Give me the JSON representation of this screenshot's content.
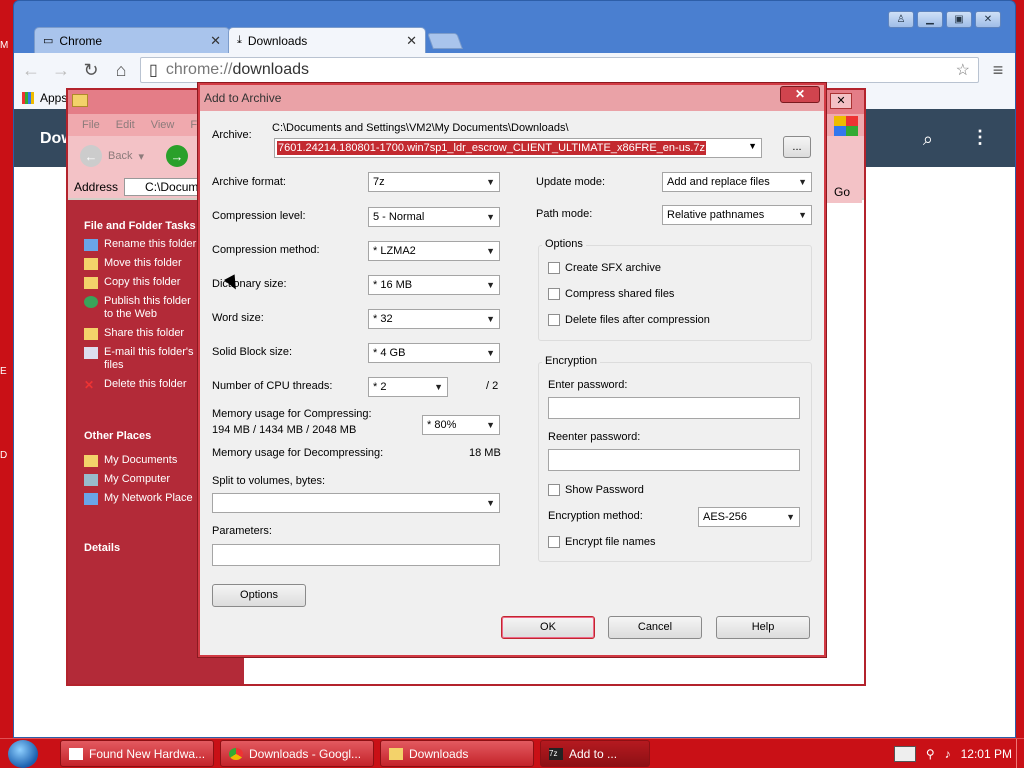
{
  "chrome": {
    "tabs": [
      {
        "label": "Chrome",
        "icon": "page-icon"
      },
      {
        "label": "Downloads",
        "icon": "download-icon"
      }
    ],
    "url_scheme": "chrome://",
    "url_path": "downloads",
    "bookmarks_label": "Apps",
    "page_title": "Dow"
  },
  "explorer": {
    "menu": [
      "File",
      "Edit",
      "View",
      "F"
    ],
    "back_label": "Back",
    "address_label": "Address",
    "address_value": "C:\\Docume",
    "go_label": "Go",
    "file_tasks_title": "File and Folder Tasks",
    "file_tasks": [
      "Rename this folder",
      "Move this folder",
      "Copy this folder",
      "Publish this folder to the Web",
      "Share this folder",
      "E-mail this folder's files",
      "Delete this folder"
    ],
    "other_places_title": "Other Places",
    "other_places": [
      "My Documents",
      "My Computer",
      "My Network Place"
    ],
    "details_title": "Details"
  },
  "dialog": {
    "title": "Add to Archive",
    "close": "✕",
    "archive_label": "Archive:",
    "archive_path": "C:\\Documents and Settings\\VM2\\My Documents\\Downloads\\",
    "archive_name": "7601.24214.180801-1700.win7sp1_ldr_escrow_CLIENT_ULTIMATE_x86FRE_en-us.7z",
    "browse": "...",
    "format_label": "Archive format:",
    "format_value": "7z",
    "level_label": "Compression level:",
    "level_value": "5 - Normal",
    "method_label": "Compression method:",
    "method_value": "* LZMA2",
    "dict_label": "Dictionary size:",
    "dict_value": "* 16 MB",
    "word_label": "Word size:",
    "word_value": "* 32",
    "solid_label": "Solid Block size:",
    "solid_value": "* 4 GB",
    "threads_label": "Number of CPU threads:",
    "threads_value": "* 2",
    "threads_total": "/ 2",
    "mem_comp_label": "Memory usage for Compressing:",
    "mem_comp_value": "194 MB / 1434 MB / 2048 MB",
    "mem_comp_pct": "* 80%",
    "mem_decomp_label": "Memory usage for Decompressing:",
    "mem_decomp_value": "18 MB",
    "split_label": "Split to volumes, bytes:",
    "split_value": "",
    "params_label": "Parameters:",
    "params_value": "",
    "options_button": "Options",
    "update_label": "Update mode:",
    "update_value": "Add and replace files",
    "path_label": "Path mode:",
    "path_value": "Relative pathnames",
    "options_group": "Options",
    "opt_sfx": "Create SFX archive",
    "opt_shared": "Compress shared files",
    "opt_delete": "Delete files after compression",
    "enc_group": "Encryption",
    "enter_pw_label": "Enter password:",
    "reenter_pw_label": "Reenter password:",
    "show_pw": "Show Password",
    "enc_method_label": "Encryption method:",
    "enc_method_value": "AES-256",
    "enc_names": "Encrypt file names",
    "ok": "OK",
    "cancel": "Cancel",
    "help": "Help"
  },
  "taskbar": {
    "items": [
      "Found New Hardwa...",
      "Downloads - Googl...",
      "Downloads",
      "Add to ..."
    ],
    "clock": "12:01 PM"
  }
}
